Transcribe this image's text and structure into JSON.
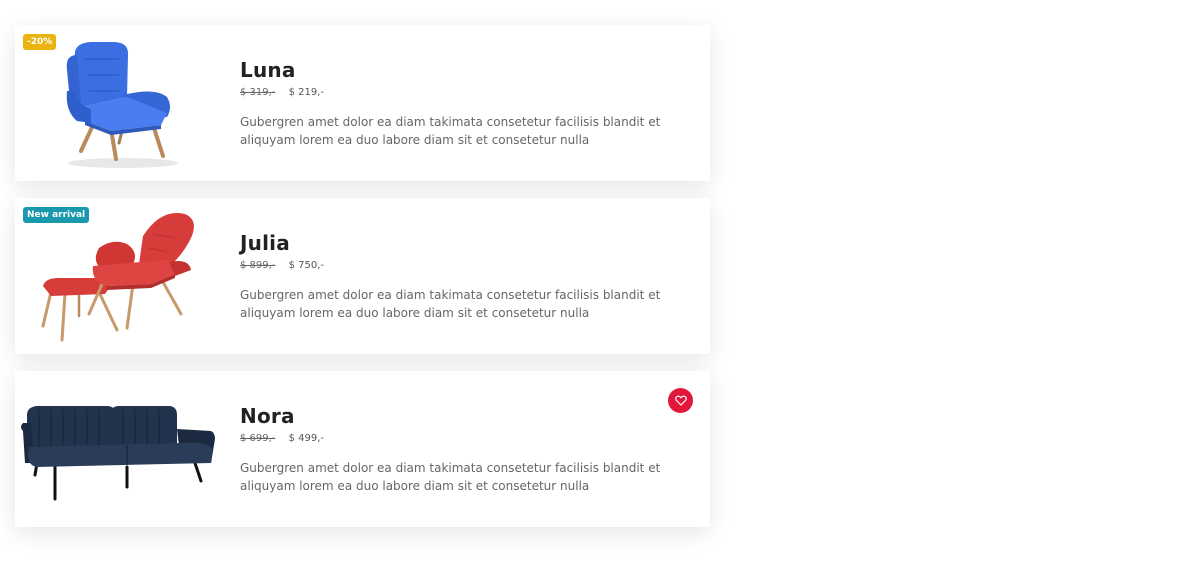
{
  "theme": {
    "badge_sale_color": "#e9b40f",
    "badge_new_color": "#1a98ad",
    "favorite_color": "#e3173b",
    "chair_blue": "#3b6ee0",
    "chair_red": "#d63c3a",
    "sofa_navy": "#1e2d44"
  },
  "products": [
    {
      "name": "Luna",
      "old_price": "$ 319,-",
      "price": "$ 219,-",
      "badge": "-20%",
      "description": "Gubergren amet dolor ea diam takimata consetetur facilisis blandit et aliquyam lorem ea duo labore diam sit et consetetur nulla",
      "image": "blue-armchair-image"
    },
    {
      "name": "Julia",
      "old_price": "$ 899,-",
      "price": "$ 750,-",
      "badge": "New arrival",
      "description": "Gubergren amet dolor ea diam takimata consetetur facilisis blandit et aliquyam lorem ea duo labore diam sit et consetetur nulla",
      "image": "red-armchair-ottoman-image"
    },
    {
      "name": "Nora",
      "old_price": "$ 699,-",
      "price": "$ 499,-",
      "favorite_icon": "heart-icon",
      "description": "Gubergren amet dolor ea diam takimata consetetur facilisis blandit et aliquyam lorem ea duo labore diam sit et consetetur nulla",
      "image": "navy-sofa-image"
    }
  ]
}
